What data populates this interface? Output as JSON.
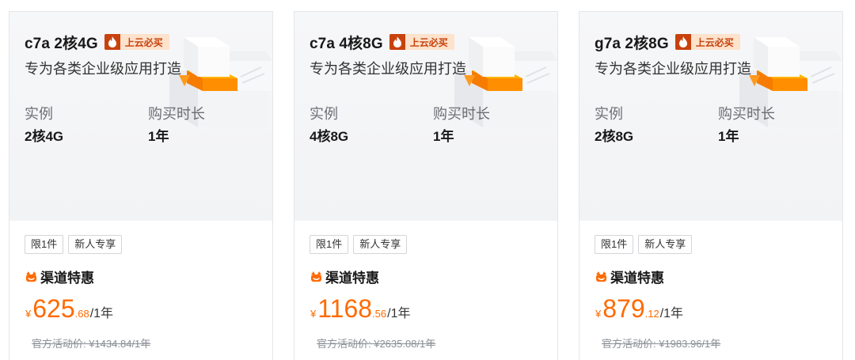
{
  "colors": {
    "accent_orange": "#ff6a00",
    "hot_badge_bg": "#fde2cc",
    "hot_badge_icon_bg": "#c8420d",
    "card_top_bg": "#f4f5f7",
    "border": "#e4e6ea"
  },
  "cards": [
    {
      "title": "c7a 2核4G",
      "hot_label": "上云必买",
      "subtitle": "专为各类企业级应用打造",
      "instance_label": "实例",
      "instance_value": "2核4G",
      "duration_label": "购买时长",
      "duration_value": "1年",
      "tags": [
        "限1件",
        "新人专享"
      ],
      "channel_label": "渠道特惠",
      "price_currency": "¥",
      "price_integer": "625",
      "price_decimal": ".68",
      "price_unit": "/1年",
      "original_price": "官方活动价: ¥1434.84/1年"
    },
    {
      "title": "c7a 4核8G",
      "hot_label": "上云必买",
      "subtitle": "专为各类企业级应用打造",
      "instance_label": "实例",
      "instance_value": "4核8G",
      "duration_label": "购买时长",
      "duration_value": "1年",
      "tags": [
        "限1件",
        "新人专享"
      ],
      "channel_label": "渠道特惠",
      "price_currency": "¥",
      "price_integer": "1168",
      "price_decimal": ".56",
      "price_unit": "/1年",
      "original_price": "官方活动价: ¥2635.08/1年"
    },
    {
      "title": "g7a 2核8G",
      "hot_label": "上云必买",
      "subtitle": "专为各类企业级应用打造",
      "instance_label": "实例",
      "instance_value": "2核8G",
      "duration_label": "购买时长",
      "duration_value": "1年",
      "tags": [
        "限1件",
        "新人专享"
      ],
      "channel_label": "渠道特惠",
      "price_currency": "¥",
      "price_integer": "879",
      "price_decimal": ".12",
      "price_unit": "/1年",
      "original_price": "官方活动价: ¥1983.96/1年"
    }
  ]
}
